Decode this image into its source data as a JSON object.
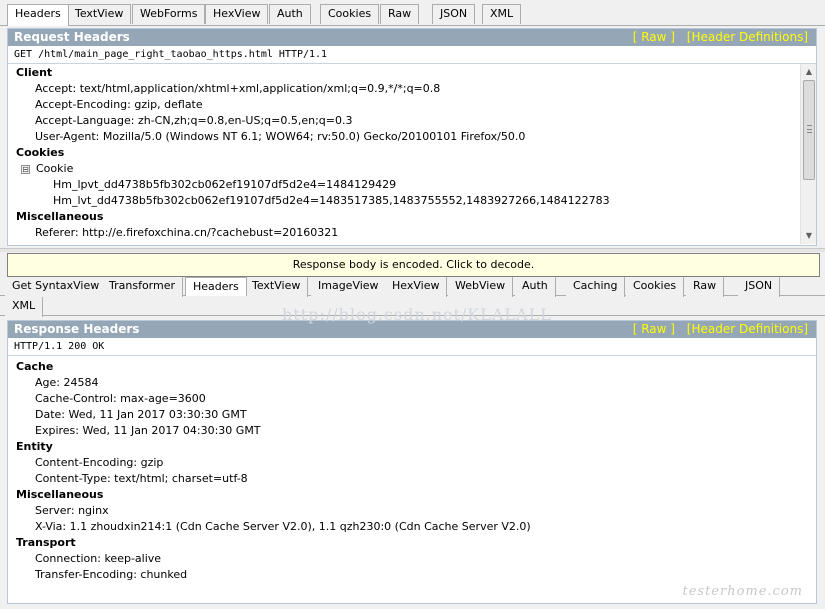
{
  "top_tabs": {
    "items": [
      "Headers",
      "TextView",
      "WebForms",
      "HexView",
      "Auth",
      "Cookies",
      "Raw",
      "JSON",
      "XML"
    ],
    "active": "Headers"
  },
  "request": {
    "title": "Request Headers",
    "raw_link": "[ Raw ]",
    "defs_link": "[Header Definitions]",
    "request_line": "GET /html/main_page_right_taobao_https.html HTTP/1.1",
    "client_label": "Client",
    "client_items": [
      "Accept: text/html,application/xhtml+xml,application/xml;q=0.9,*/*;q=0.8",
      "Accept-Encoding: gzip, deflate",
      "Accept-Language: zh-CN,zh;q=0.8,en-US;q=0.5,en;q=0.3",
      "User-Agent: Mozilla/5.0 (Windows NT 6.1; WOW64; rv:50.0) Gecko/20100101 Firefox/50.0"
    ],
    "cookies_label": "Cookies",
    "cookie_node": "Cookie",
    "cookie_toggle": "⊟",
    "cookie_items": [
      "Hm_lpvt_dd4738b5fb302cb062ef19107df5d2e4=1484129429",
      "Hm_lvt_dd4738b5fb302cb062ef19107df5d2e4=1483517385,1483755552,1483927266,1484122783"
    ],
    "misc_label": "Miscellaneous",
    "misc_items": [
      "Referer: http://e.firefoxchina.cn/?cachebust=20160321"
    ]
  },
  "notice": {
    "text": "Response body is encoded. Click to decode."
  },
  "response_tabs": {
    "items": [
      "Get SyntaxView",
      "Transformer",
      "Headers",
      "TextView",
      "ImageView",
      "HexView",
      "WebView",
      "Auth",
      "Caching",
      "Cookies",
      "Raw",
      "JSON"
    ],
    "items_row2": [
      "XML"
    ],
    "active": "Headers"
  },
  "response": {
    "title": "Response Headers",
    "raw_link": "[ Raw ]",
    "defs_link": "[Header Definitions]",
    "status_line": "HTTP/1.1 200 OK",
    "cache_label": "Cache",
    "cache_items": [
      "Age: 24584",
      "Cache-Control: max-age=3600",
      "Date: Wed, 11 Jan 2017 03:30:30 GMT",
      "Expires: Wed, 11 Jan 2017 04:30:30 GMT"
    ],
    "entity_label": "Entity",
    "entity_items": [
      "Content-Encoding: gzip",
      "Content-Type: text/html; charset=utf-8"
    ],
    "misc_label": "Miscellaneous",
    "misc_items": [
      "Server: nginx",
      "X-Via: 1.1 zhoudxin214:1 (Cdn Cache Server V2.0), 1.1 qzh230:0 (Cdn Cache Server V2.0)"
    ],
    "transport_label": "Transport",
    "transport_items": [
      "Connection: keep-alive",
      "Transfer-Encoding: chunked"
    ]
  },
  "watermark": "http://blog.csdn.net/KLALALL",
  "brandmark": "testerhome.com"
}
